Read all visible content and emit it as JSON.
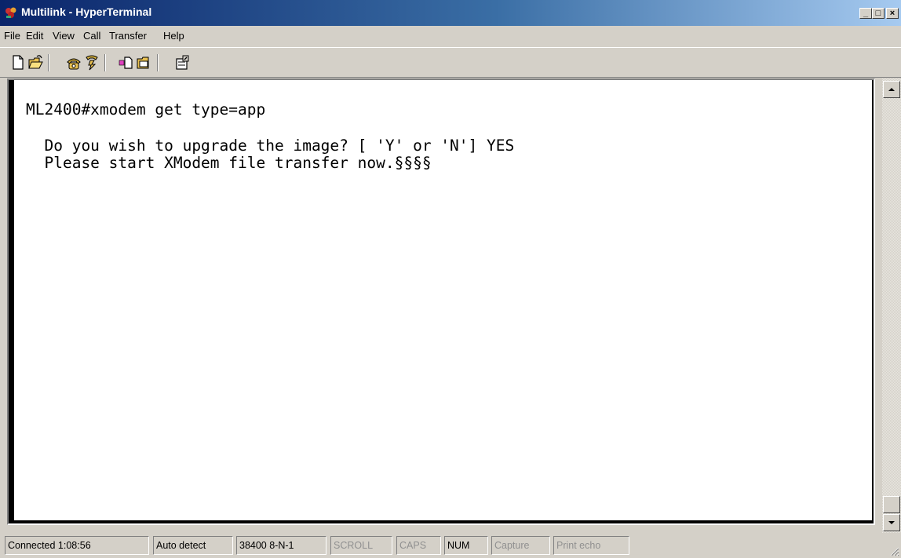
{
  "window": {
    "title": "Multilink - HyperTerminal",
    "controls": {
      "minimize": "_",
      "maximize": "□",
      "close": "×"
    }
  },
  "menu": {
    "items": [
      {
        "label": "File"
      },
      {
        "label": "Edit"
      },
      {
        "label": "View"
      },
      {
        "label": "Call"
      },
      {
        "label": "Transfer"
      },
      {
        "label": "Help"
      }
    ]
  },
  "toolbar": {
    "buttons": [
      "new-connection-icon",
      "open-icon",
      "connect-phone-icon",
      "disconnect-phone-icon",
      "send-file-icon",
      "receive-file-icon",
      "properties-icon"
    ]
  },
  "terminal": {
    "lines": [
      "ML2400#xmodem get type=app",
      "",
      "  Do you wish to upgrade the image? [ 'Y' or 'N'] YES",
      "  Please start XModem file transfer now.§§§§"
    ]
  },
  "status": {
    "connected": "Connected 1:08:56",
    "detect": "Auto detect",
    "settings": "38400 8-N-1",
    "scroll": "SCROLL",
    "caps": "CAPS",
    "num": "NUM",
    "capture": "Capture",
    "print_echo": "Print echo"
  },
  "colors": {
    "title_start": "#0a246a",
    "title_end": "#a6caf0",
    "face": "#d4d0c8",
    "terminal_bg": "#ffffff"
  }
}
